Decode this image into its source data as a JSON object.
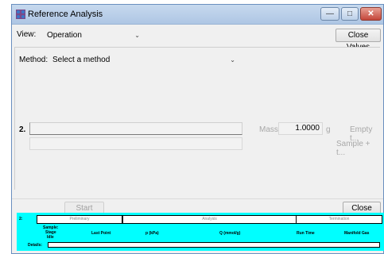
{
  "window": {
    "title": "Reference Analysis",
    "minimize_glyph": "—",
    "maximize_glyph": "□",
    "close_glyph": "✕"
  },
  "viewbar": {
    "view_label": "View:",
    "view_value": "Operation",
    "close_valves_label": "Close Valves"
  },
  "method": {
    "label": "Method:",
    "value": "Select a method"
  },
  "sample": {
    "index_label": "2.",
    "mass_label": "Mass:",
    "mass_value": "1.0000",
    "mass_unit": "g",
    "empty_label": "Empty t...",
    "sample_label": "Sample + t..."
  },
  "bottom": {
    "start_label": "Start",
    "close_label": "Close"
  },
  "status": {
    "port_label": "2:",
    "stages": [
      "Preliminary",
      "Analysis",
      "Termination"
    ],
    "info_lines": [
      "Sample:",
      "Stage",
      "Idle"
    ],
    "columns": [
      "Last Point",
      "p (kPa)",
      "Q (mmol/g)",
      "Run Time",
      "Manifold Gas"
    ],
    "details_label": "Details:"
  },
  "colors": {
    "status_background": "#00ffff",
    "titlebar": "#b8cde8"
  },
  "icons": {
    "app": "pattern-grid-icon",
    "dropdown": "chevron-down-icon"
  }
}
